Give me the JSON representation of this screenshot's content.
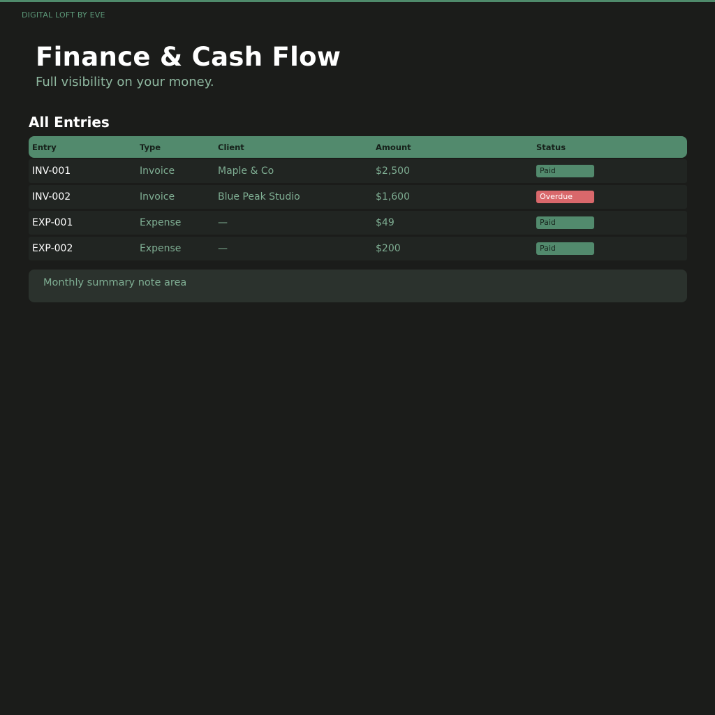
{
  "brand": "DIGITAL LOFT BY EVE",
  "header": {
    "title": "Finance & Cash Flow",
    "subtitle": "Full visibility on your money."
  },
  "section": {
    "title": "All Entries"
  },
  "table": {
    "columns": [
      "Entry",
      "Type",
      "Client",
      "Amount",
      "Status"
    ],
    "rows": [
      {
        "entry": "INV-001",
        "type": "Invoice",
        "client": "Maple & Co",
        "amount": "$2,500",
        "status": "Paid"
      },
      {
        "entry": "INV-002",
        "type": "Invoice",
        "client": "Blue Peak Studio",
        "amount": "$1,600",
        "status": "Overdue"
      },
      {
        "entry": "EXP-001",
        "type": "Expense",
        "client": "—",
        "amount": "$49",
        "status": "Paid"
      },
      {
        "entry": "EXP-002",
        "type": "Expense",
        "client": "—",
        "amount": "$200",
        "status": "Paid"
      }
    ]
  },
  "status_colors": {
    "Paid": {
      "bg": "#528a6d",
      "fg": "#16201a"
    },
    "Overdue": {
      "bg": "#d9686b",
      "fg": "#ffffff"
    }
  },
  "colors": {
    "accent": "#4f8a6b",
    "background": "#1b1c1a"
  },
  "note": {
    "text": "Monthly summary note area"
  }
}
